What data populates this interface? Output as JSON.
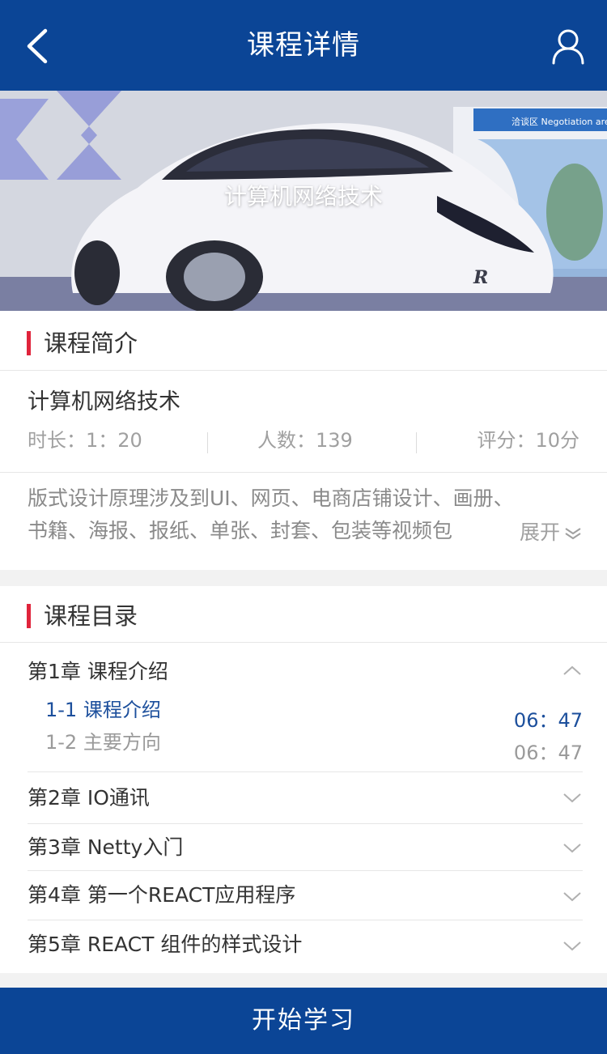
{
  "header": {
    "title": "课程详情",
    "back_icon": "back-arrow-icon",
    "user_icon": "user-icon"
  },
  "banner": {
    "caption": "计算机网络技术",
    "sign_text": "洽谈区 Negotiation area"
  },
  "intro": {
    "section_title": "课程简介",
    "course_name": "计算机网络技术",
    "duration": "时长：1：20",
    "people": "人数：139",
    "rating": "评分：10分",
    "description_line1": "版式设计原理涉及到UI、网页、电商店铺设计、画册、",
    "description_line2": "书籍、海报、报纸、单张、封套、包装等视频包",
    "expand_label": "展开"
  },
  "catalog": {
    "section_title": "课程目录",
    "chapters": [
      {
        "title": "第1章 课程介绍",
        "expanded": true,
        "lessons": [
          {
            "title": "1-1 课程介绍",
            "time": "06：47",
            "active": true
          },
          {
            "title": "1-2 主要方向",
            "time": "06：47",
            "active": false
          }
        ]
      },
      {
        "title": "第2章 IO通讯",
        "expanded": false
      },
      {
        "title": "第3章 Netty入门",
        "expanded": false
      },
      {
        "title": "第4章 第一个REACT应用程序",
        "expanded": false
      },
      {
        "title": "第5章 REACT 组件的样式设计",
        "expanded": false
      }
    ]
  },
  "footer": {
    "start_label": "开始学习"
  },
  "colors": {
    "primary": "#0b4596",
    "accent": "#e0243b",
    "active_lesson": "#1c4f9c"
  }
}
